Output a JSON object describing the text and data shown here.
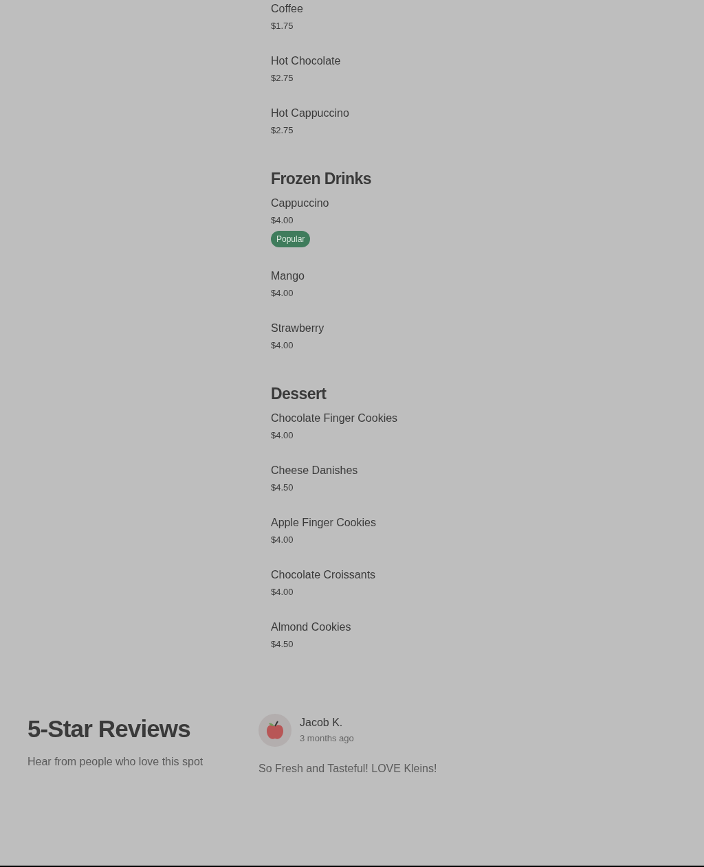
{
  "menu_sections": [
    {
      "items": [
        {
          "name": "Coffee",
          "price": "$1.75"
        },
        {
          "name": "Hot Chocolate",
          "price": "$2.75"
        },
        {
          "name": "Hot Cappuccino",
          "price": "$2.75"
        }
      ]
    },
    {
      "title": "Frozen Drinks",
      "items": [
        {
          "name": "Cappuccino",
          "price": "$4.00",
          "badge": "Popular"
        },
        {
          "name": "Mango",
          "price": "$4.00"
        },
        {
          "name": "Strawberry",
          "price": "$4.00"
        }
      ]
    },
    {
      "title": "Dessert",
      "items": [
        {
          "name": "Chocolate Finger Cookies",
          "price": "$4.00"
        },
        {
          "name": "Cheese Danishes",
          "price": "$4.50"
        },
        {
          "name": "Apple Finger Cookies",
          "price": "$4.00"
        },
        {
          "name": "Chocolate Croissants",
          "price": "$4.00"
        },
        {
          "name": "Almond Cookies",
          "price": "$4.50"
        }
      ]
    }
  ],
  "reviews_section": {
    "title": "5-Star Reviews",
    "subtitle": "Hear from people who love this spot",
    "reviews": [
      {
        "author": "Jacob K.",
        "time": "3 months ago",
        "text": "So Fresh and Tasteful! LOVE Kleins!"
      }
    ]
  }
}
